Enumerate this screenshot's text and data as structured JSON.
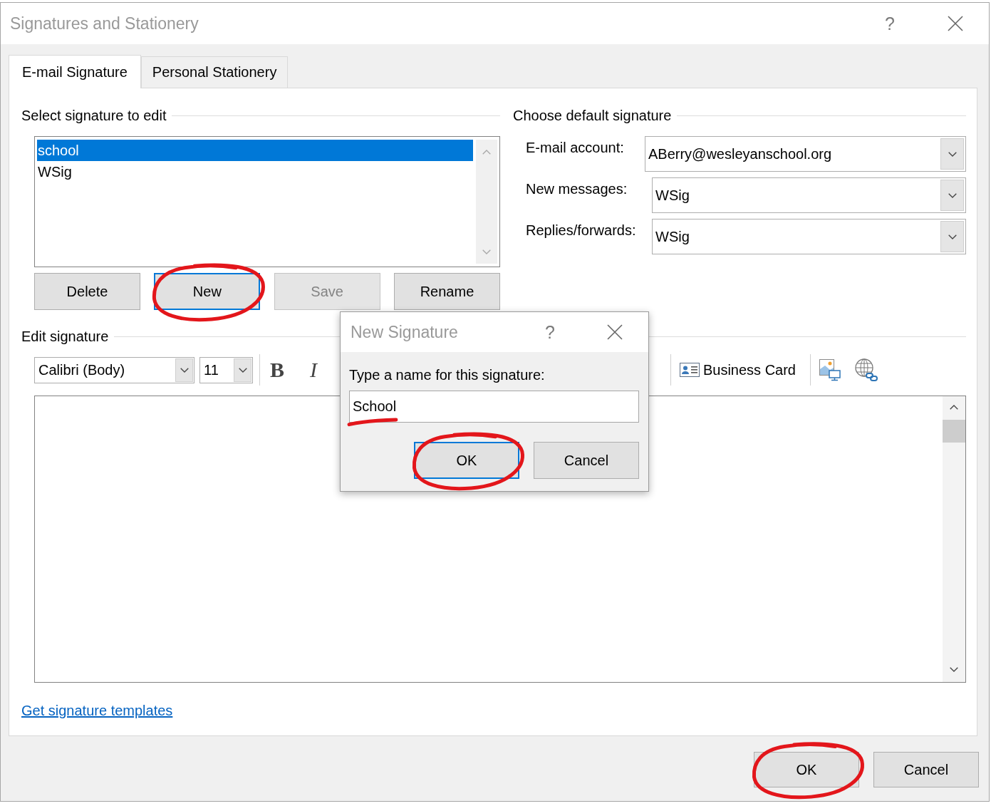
{
  "window": {
    "title": "Signatures and Stationery",
    "help_button": "?"
  },
  "tabs": [
    {
      "label": "E-mail Signature",
      "selected": true
    },
    {
      "label": "Personal Stationery",
      "selected": false
    }
  ],
  "select_signature": {
    "heading": "Select signature to edit",
    "signatures": [
      {
        "name": "school",
        "selected": true
      },
      {
        "name": "WSig",
        "selected": false
      }
    ],
    "buttons": [
      {
        "label": "Delete",
        "disabled": false,
        "focused": false,
        "circled": false
      },
      {
        "label": "New",
        "disabled": false,
        "focused": true,
        "circled": true
      },
      {
        "label": "Save",
        "disabled": true,
        "focused": false,
        "circled": false
      },
      {
        "label": "Rename",
        "disabled": false,
        "focused": false,
        "circled": false
      }
    ]
  },
  "default_signature": {
    "heading": "Choose default signature",
    "fields": [
      {
        "label": "E-mail account:",
        "value": "ABerry@wesleyanschool.org"
      },
      {
        "label": "New messages:",
        "value": "WSig"
      },
      {
        "label": "Replies/forwards:",
        "value": "WSig"
      }
    ]
  },
  "edit_signature": {
    "heading": "Edit signature",
    "font": "Calibri (Body)",
    "font_size": "11",
    "bold_button": "B",
    "italic_button": "I",
    "business_card_button": "Business Card"
  },
  "templates_link": "Get signature templates",
  "buttons": [
    {
      "label": "OK",
      "circled": true
    },
    {
      "label": "Cancel",
      "circled": false
    }
  ],
  "new_signature_dialog": {
    "title": "New Signature",
    "help_button": "?",
    "prompt": "Type a name for this signature:",
    "name_field": {
      "value": "School",
      "scribble_underline": true
    },
    "buttons": [
      {
        "label": "OK",
        "focused": true,
        "circled": true
      },
      {
        "label": "Cancel",
        "focused": false,
        "circled": false
      }
    ]
  }
}
